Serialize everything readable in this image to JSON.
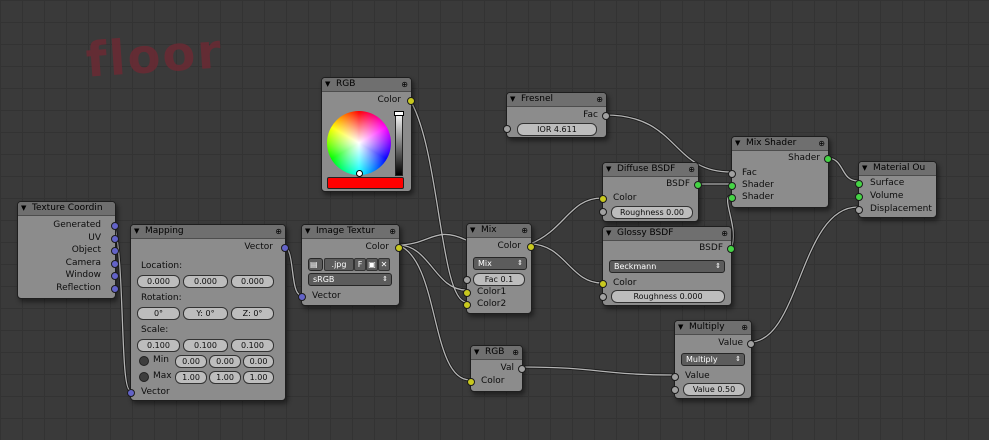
{
  "annotation": "floor",
  "nodes": {
    "texcoord": {
      "title": "Texture Coordin",
      "outputs": [
        "Generated",
        "UV",
        "Object",
        "Camera",
        "Window",
        "Reflection"
      ]
    },
    "mapping": {
      "title": "Mapping",
      "output": "Vector",
      "location_label": "Location:",
      "location": [
        "0.000",
        "0.000",
        "0.000"
      ],
      "rotation_label": "Rotation:",
      "rotation": [
        "0°",
        "Y: 0°",
        "Z: 0°"
      ],
      "scale_label": "Scale:",
      "scale": [
        "0.100",
        "0.100",
        "0.100"
      ],
      "min_label": "Min",
      "min": [
        "0.00",
        "0.00",
        "0.00"
      ],
      "max_label": "Max",
      "max": [
        "1.00",
        "1.00",
        "1.00"
      ],
      "input": "Vector"
    },
    "image": {
      "title": "Image Textur",
      "output": "Color",
      "file": ".jpg",
      "fake_btn": "F",
      "colorspace": "sRGB",
      "input": "Vector"
    },
    "rgb1": {
      "title": "RGB",
      "output": "Color",
      "color": "#ff0000"
    },
    "mix": {
      "title": "Mix",
      "output": "Color",
      "blend": "Mix",
      "fac": "Fac 0.1",
      "inputs": [
        "Color1",
        "Color2"
      ]
    },
    "rgb2": {
      "title": "RGB",
      "output": "Val",
      "input": "Color"
    },
    "fresnel": {
      "title": "Fresnel",
      "output": "Fac",
      "ior": "IOR 4.611"
    },
    "diffuse": {
      "title": "Diffuse BSDF",
      "output": "BSDF",
      "input": "Color",
      "roughness": "Roughness 0.00"
    },
    "glossy": {
      "title": "Glossy BSDF",
      "output": "BSDF",
      "distribution": "Beckmann",
      "input": "Color",
      "roughness": "Roughness 0.000"
    },
    "mixshader": {
      "title": "Mix Shader",
      "output": "Shader",
      "inputs": [
        "Fac",
        "Shader",
        "Shader"
      ]
    },
    "multiply": {
      "title": "Multiply",
      "output": "Value",
      "operation": "Multiply",
      "input": "Value",
      "value": "Value 0.50"
    },
    "matout": {
      "title": "Material Ou",
      "inputs": [
        "Surface",
        "Volume",
        "Displacement"
      ]
    }
  },
  "colors": {
    "link": "#b4b4b4",
    "yellow_socket": "#c8c81f",
    "green_socket": "#45d445",
    "blue_socket": "#6363c7"
  }
}
